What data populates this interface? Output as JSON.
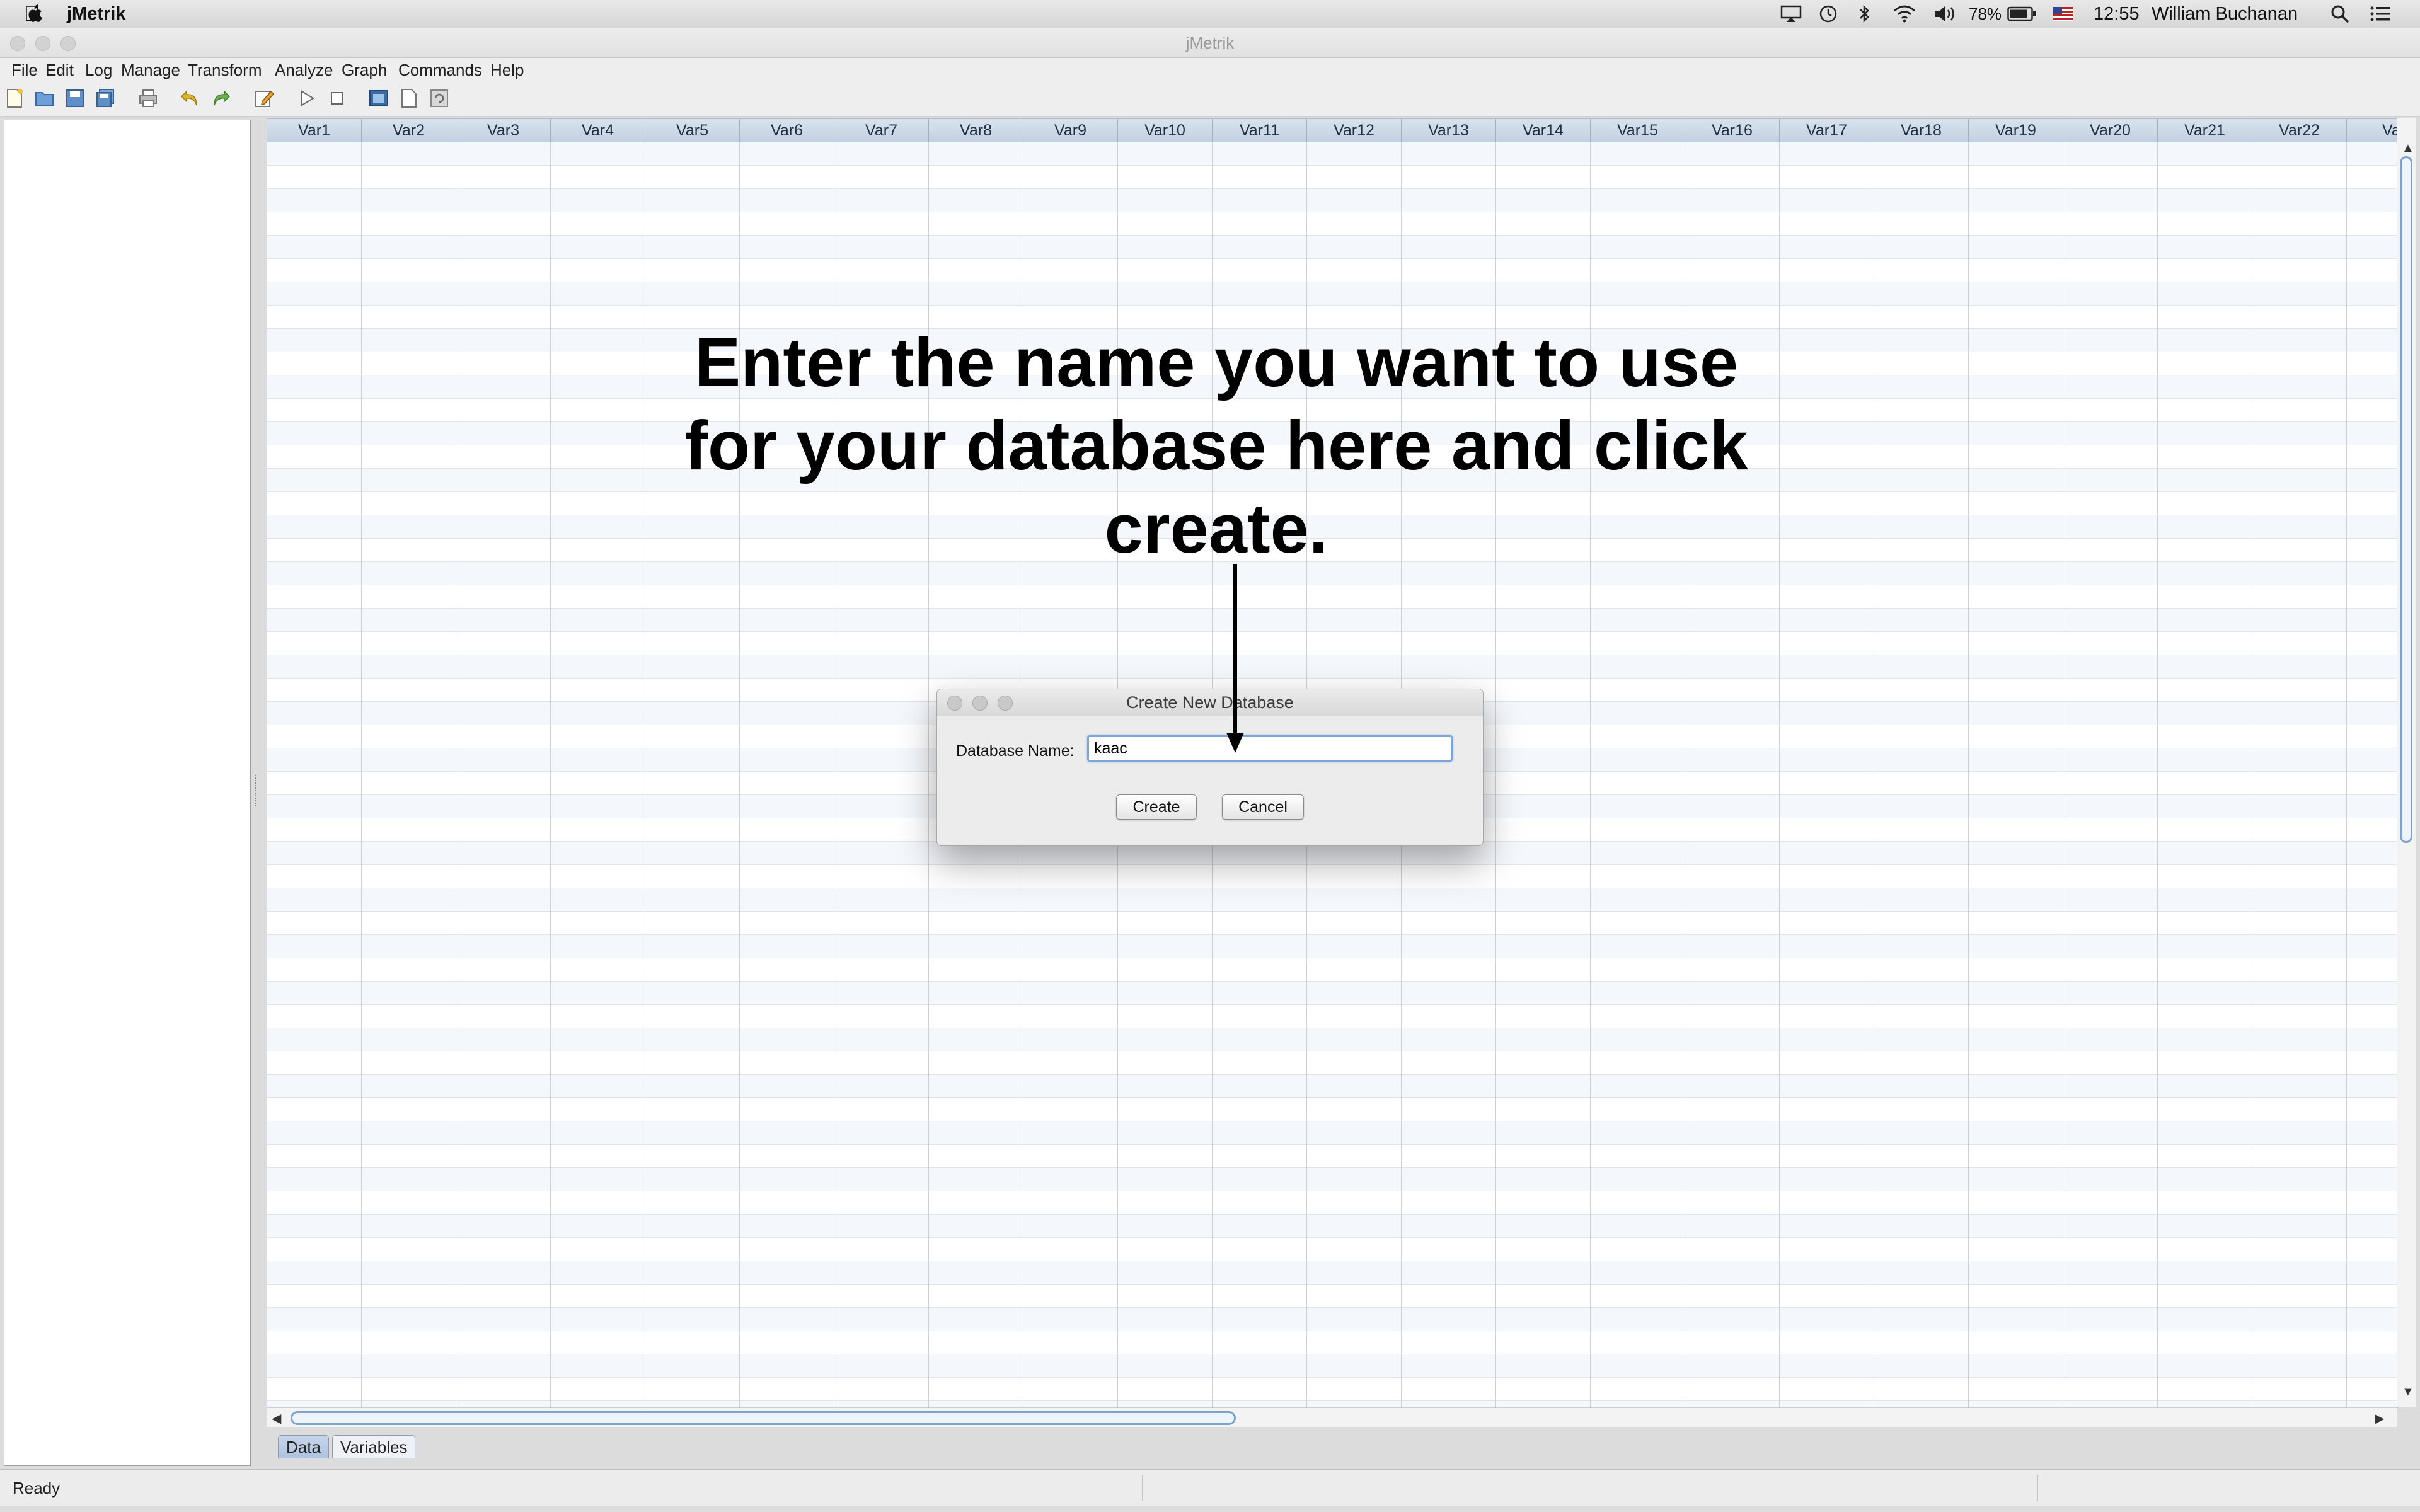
{
  "system_menubar": {
    "app_name": "jMetrik",
    "battery": "78%",
    "time": "12:55",
    "user": "William Buchanan"
  },
  "window": {
    "title": "jMetrik"
  },
  "menu": [
    "File",
    "Edit",
    "Log",
    "Manage",
    "Transform",
    "Analyze",
    "Graph",
    "Commands",
    "Help"
  ],
  "toolbar_icons": [
    "new-file-icon",
    "open-folder-icon",
    "save-icon",
    "save-all-icon",
    "print-icon",
    "undo-icon",
    "redo-icon",
    "edit-icon",
    "run-icon",
    "stop-icon",
    "screenshot-icon",
    "document-icon",
    "refresh-icon"
  ],
  "grid": {
    "columns": [
      "Var1",
      "Var2",
      "Var3",
      "Var4",
      "Var5",
      "Var6",
      "Var7",
      "Var8",
      "Var9",
      "Var10",
      "Var11",
      "Var12",
      "Var13",
      "Var14",
      "Var15",
      "Var16",
      "Var17",
      "Var18",
      "Var19",
      "Var20",
      "Var21",
      "Var22",
      "Var"
    ]
  },
  "tabs": [
    "Data",
    "Variables"
  ],
  "status": "Ready",
  "annotation": {
    "lines": [
      "Enter the name you want to use",
      "for your database here and click",
      "create."
    ]
  },
  "dialog": {
    "title": "Create New Database",
    "field_label": "Database Name:",
    "field_value": "kaac",
    "create_label": "Create",
    "cancel_label": "Cancel"
  },
  "colors": {
    "grid_header": "#c9d6e6",
    "scroll_accent": "#7fa3c8",
    "annotation": "#000000"
  }
}
